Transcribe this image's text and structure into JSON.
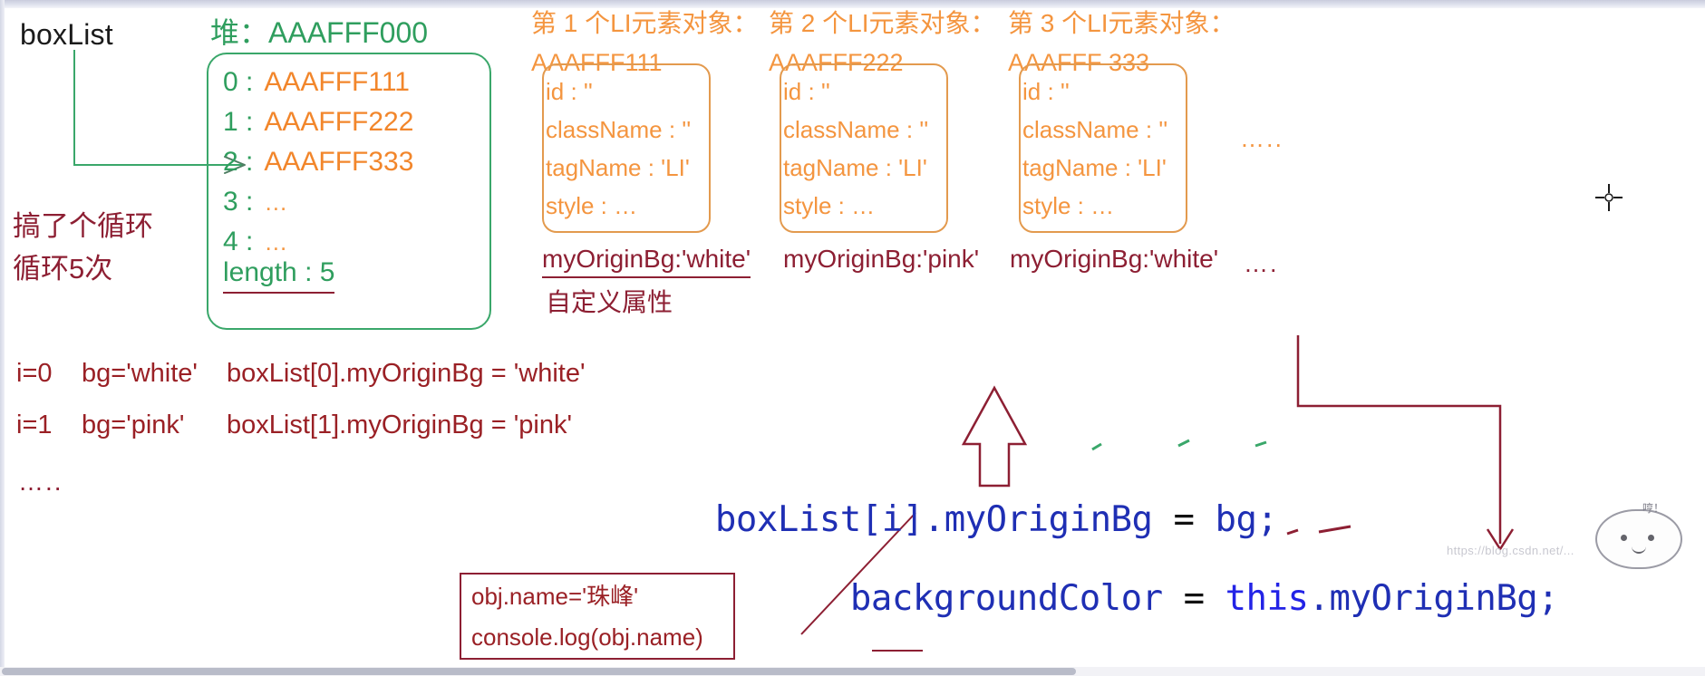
{
  "heap": {
    "var_label": "boxList",
    "title": "堆：AAAFFF000",
    "entries": [
      {
        "key": "0 :",
        "value": "AAAFFF111"
      },
      {
        "key": "1 :",
        "value": "AAAFFF222"
      },
      {
        "key": "2 :",
        "value": "AAAFFF333"
      },
      {
        "key": "3 :",
        "value": "…"
      },
      {
        "key": "4 :",
        "value": "…"
      }
    ],
    "length_line": "length : 5"
  },
  "loop_note": {
    "line1": "搞了个循环",
    "line2": "循环5次"
  },
  "li_objects": [
    {
      "heading": "第 1 个LI元素对象：",
      "address": "AAAFFF111",
      "props": [
        "id : ''",
        "className : ''",
        "tagName : 'LI'",
        "style : …"
      ],
      "custom_prop": "myOriginBg:'white'"
    },
    {
      "heading": "第 2 个LI元素对象：",
      "address": "AAAFFF222",
      "props": [
        "id : ''",
        "className : ''",
        "tagName : 'LI'",
        "style : …"
      ],
      "custom_prop": "myOriginBg:'pink'"
    },
    {
      "heading": "第 3 个LI元素对象：",
      "address": "AAAFFF 333",
      "props": [
        "id : ''",
        "className : ''",
        "tagName : 'LI'",
        "style : …"
      ],
      "custom_prop": "myOriginBg:'white'"
    }
  ],
  "custom_prop_label": "自定义属性",
  "li_trailing_ellipsis": "…..",
  "custom_trailing_ellipsis": "….",
  "iterations": [
    {
      "index": "i=0",
      "bg": "bg='white'",
      "statement": "boxList[0].myOriginBg = 'white'"
    },
    {
      "index": "i=1",
      "bg": "bg='pink'",
      "statement": "boxList[1].myOriginBg = 'pink'"
    }
  ],
  "iterations_ellipsis": "…..",
  "callout": {
    "line1": "obj.name='珠峰'",
    "line2": "console.log(obj.name)"
  },
  "code": {
    "line1_a": "boxList[i]",
    "line1_b": ".myOriginBg",
    "line1_c": " = ",
    "line1_d": "bg;",
    "line1_full": "boxList[i].myOriginBg = bg;",
    "line2_full": "backgroundColor = this.myOriginBg;",
    "line2_a": "backgroundColor",
    "line2_b": " = ",
    "line2_c": "this",
    "line2_d": ".myOriginBg;"
  },
  "cursor": {
    "name": "crosshair-cursor"
  },
  "watermark": {
    "text": "https://blog.csdn.net/...",
    "mascot_label": "哼！"
  },
  "colors": {
    "green": "#2f9e5e",
    "orange": "#f2862b",
    "orange_box": "#e39a4e",
    "maroon": "#8d1f33",
    "blue": "#1f2fb4",
    "black": "#1b1b1b"
  }
}
